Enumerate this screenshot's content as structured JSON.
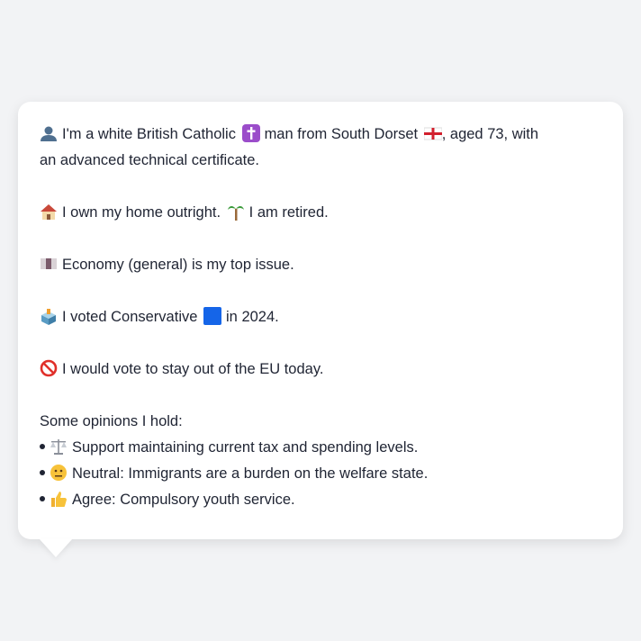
{
  "profile": {
    "line1": {
      "icon": "bust-in-silhouette",
      "a": "I'm a white British Catholic",
      "icon2": "latin-cross",
      "b": "man from South Dorset",
      "icon3": "england-flag",
      "c": ", aged 73, with"
    },
    "line2": "an advanced technical certificate.",
    "home": {
      "icon": "house",
      "a": "I own my home outright.",
      "icon2": "palm-tree",
      "b": "I am retired."
    },
    "issue": {
      "icon": "money-with-wings",
      "text": "Economy (general) is my top issue."
    },
    "vote": {
      "icon": "ballot-box",
      "a": "I voted Conservative",
      "icon2": "blue-square",
      "b": "in 2024."
    },
    "eu": {
      "icon": "no-entry-sign",
      "text": "I would vote to stay out of the EU today."
    },
    "opinions_heading": "Some opinions I hold:",
    "opinions": [
      {
        "icon": "balance-scale",
        "text": "Support maintaining current tax and spending levels."
      },
      {
        "icon": "neutral-face",
        "text": "Neutral: Immigrants are a burden on the welfare state."
      },
      {
        "icon": "thumbs-up",
        "text": "Agree: Compulsory youth service."
      }
    ]
  },
  "colors": {
    "conservative": "#1565e8",
    "background": "#f2f3f5",
    "card": "#ffffff"
  }
}
